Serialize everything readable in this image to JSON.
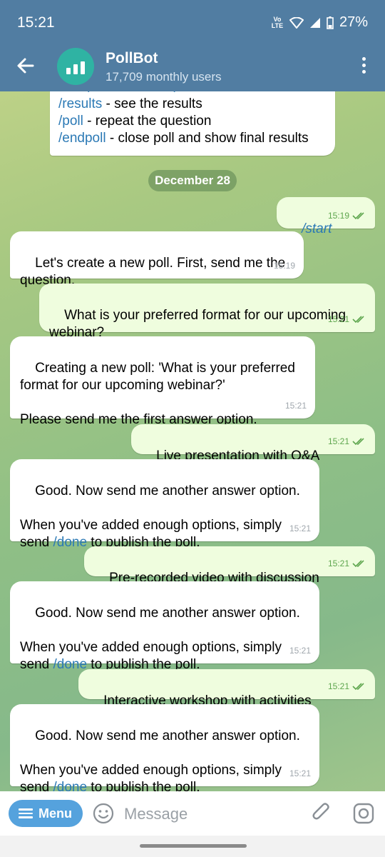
{
  "status_bar": {
    "time": "15:21",
    "network": "Vo LTE",
    "battery": "27%"
  },
  "header": {
    "title": "PollBot",
    "subtitle": "17,709 monthly users"
  },
  "top_partial": {
    "cut_line": "/newpoll - create a poll",
    "lines": [
      {
        "cmd": "/results",
        "text": " - see the results"
      },
      {
        "cmd": "/poll",
        "text": " - repeat the question"
      },
      {
        "cmd": "/endpoll",
        "text": " - close poll and show final results"
      }
    ]
  },
  "date_separator": "December 28",
  "messages": [
    {
      "dir": "out",
      "text": "/start",
      "time": "15:19"
    },
    {
      "dir": "in",
      "text": "Let's create a new poll. First, send me the question.",
      "time": "15:19"
    },
    {
      "dir": "out",
      "text": "What is your preferred format for our upcoming webinar?",
      "time": "15:21"
    },
    {
      "dir": "in",
      "text": "Creating a new poll: 'What is your preferred format for our upcoming webinar?'\n\nPlease send me the first answer option.",
      "time": "15:21"
    },
    {
      "dir": "out",
      "text": "Live presentation with Q&A",
      "time": "15:21"
    },
    {
      "dir": "in",
      "text_a": "Good. Now send me another answer option.\n\nWhen you've added enough options, simply send ",
      "link": "/done",
      "text_b": " to publish the poll.",
      "time": "15:21"
    },
    {
      "dir": "out",
      "text": "Pre-recorded video with discussion",
      "time": "15:21"
    },
    {
      "dir": "in",
      "text_a": "Good. Now send me another answer option.\n\nWhen you've added enough options, simply send ",
      "link": "/done",
      "text_b": " to publish the poll.",
      "time": "15:21"
    },
    {
      "dir": "out",
      "text": "Interactive workshop with activities",
      "time": "15:21"
    },
    {
      "dir": "in",
      "text_a": "Good. Now send me another answer option.\n\nWhen you've added enough options, simply send ",
      "link": "/done",
      "text_b": " to publish the poll.",
      "time": "15:21"
    }
  ],
  "input_bar": {
    "menu_label": "Menu",
    "placeholder": "Message"
  },
  "colors": {
    "header": "#517da2",
    "out_bubble": "#effdde",
    "in_bubble": "#ffffff",
    "link": "#2b79b5",
    "menu_button": "#55a2dd"
  }
}
